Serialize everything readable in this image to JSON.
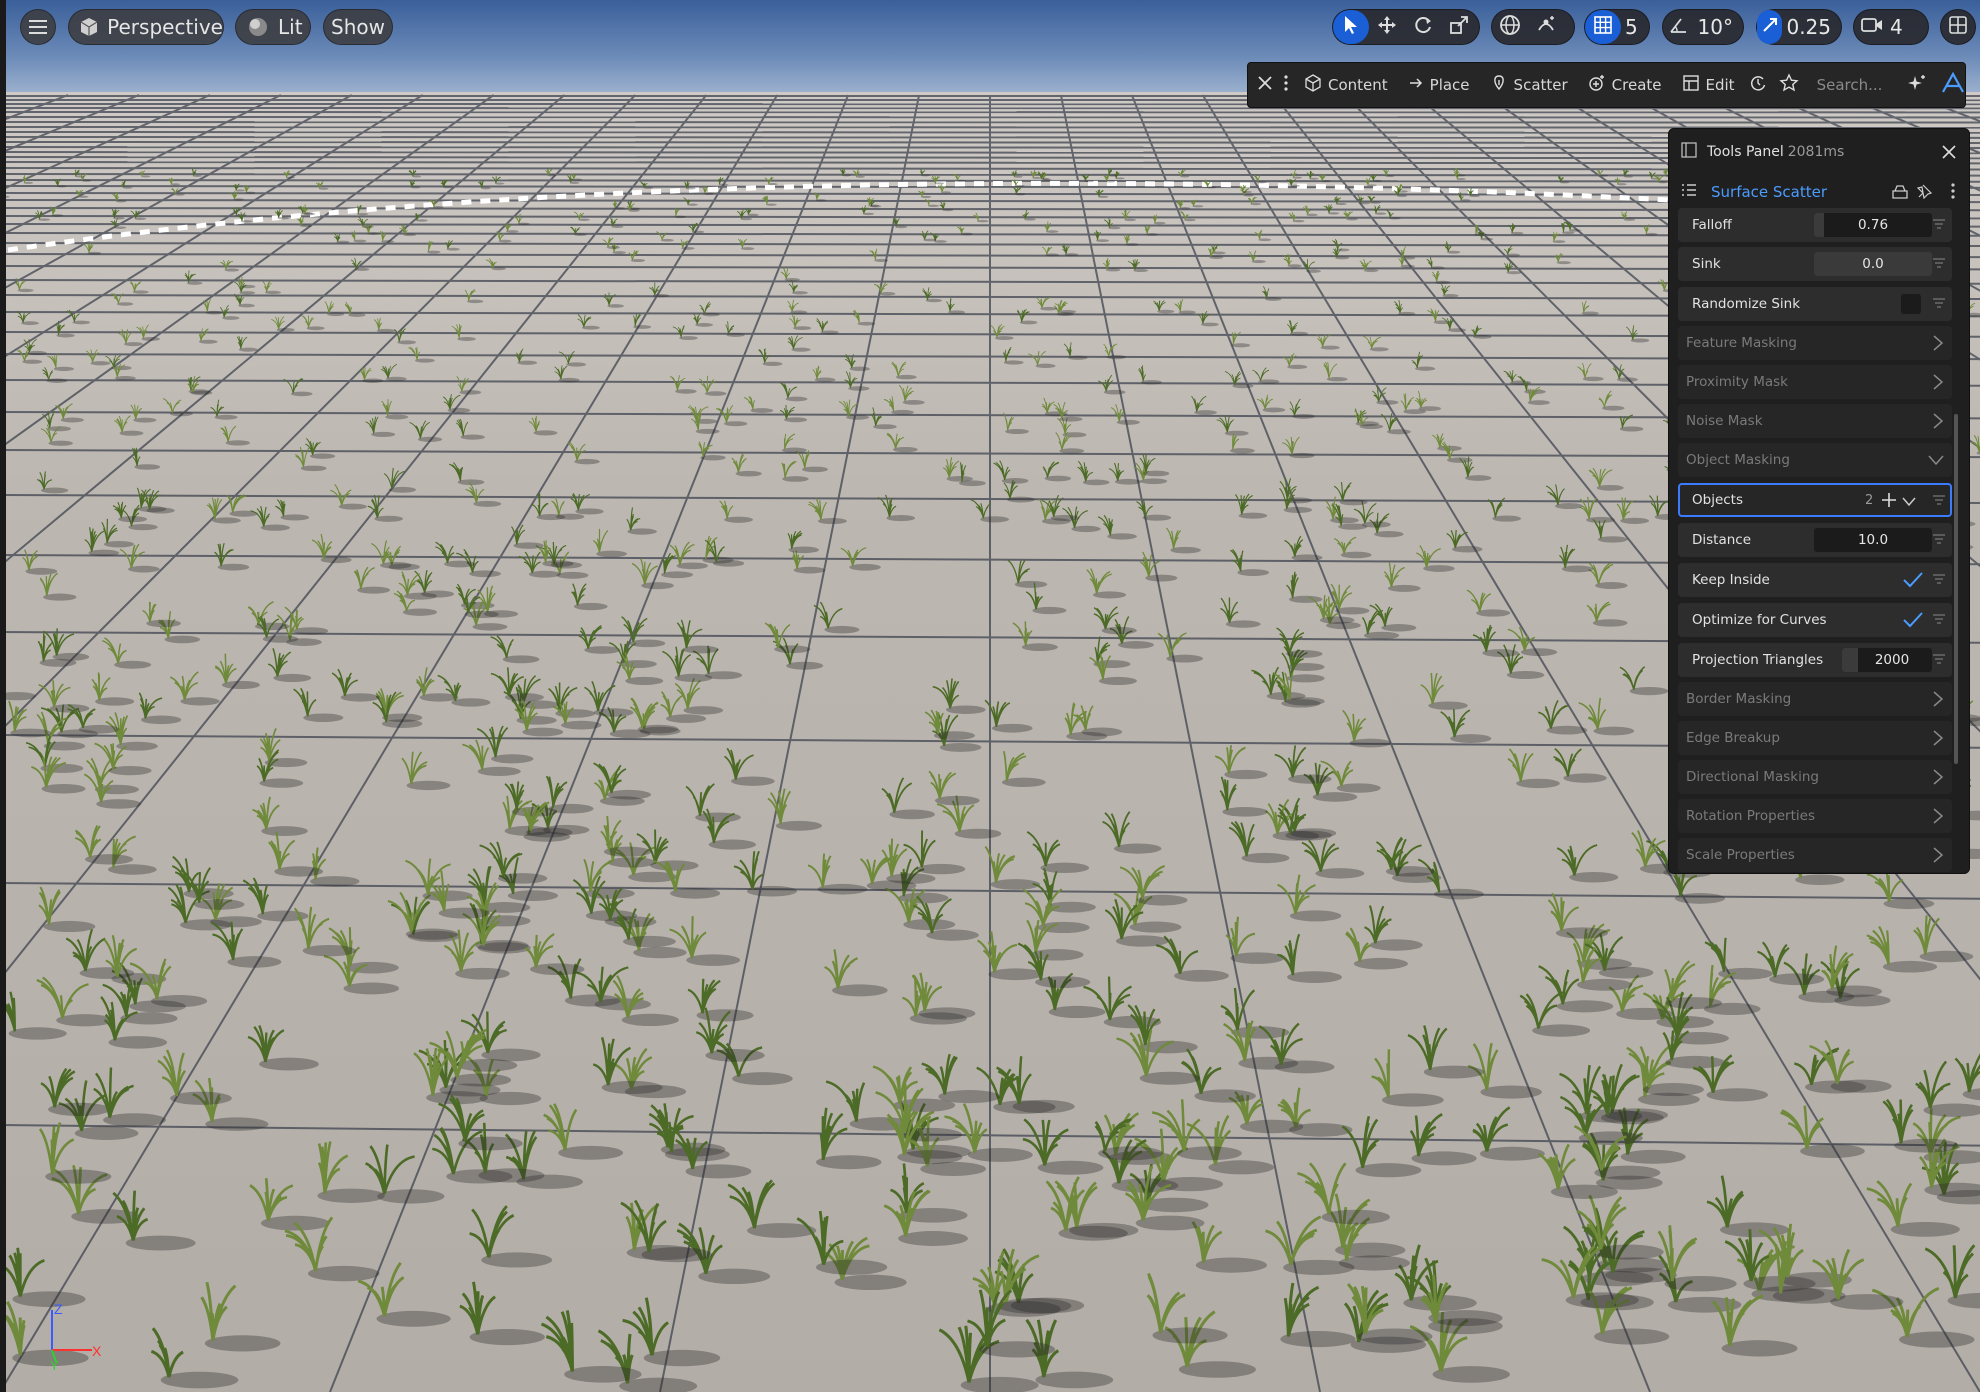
{
  "viewport": {
    "menu_icon": "hamburger-icon",
    "perspective_label": "Perspective",
    "lit_label": "Lit",
    "show_label": "Show",
    "grid_snap_value": "5",
    "rotation_snap_value": "10°",
    "scale_snap_value": "0.25",
    "camera_speed_value": "4",
    "axis_labels": {
      "z": "Z",
      "x": "X",
      "y": "Y"
    }
  },
  "modebar": {
    "content_label": "Content",
    "place_label": "Place",
    "scatter_label": "Scatter",
    "create_label": "Create",
    "edit_label": "Edit",
    "search_placeholder": "Search..."
  },
  "tools_panel": {
    "title": "Tools Panel",
    "timing": "2081ms",
    "tool_name": "Surface Scatter",
    "properties": [
      {
        "label": "Falloff",
        "value": "0.76",
        "type": "number"
      },
      {
        "label": "Sink",
        "value": "0.0",
        "type": "number"
      },
      {
        "label": "Randomize Sink",
        "value": "",
        "type": "checkbox",
        "checked": false
      }
    ],
    "sections_top": [
      "Feature Masking",
      "Proximity Mask",
      "Noise Mask",
      "Object Masking"
    ],
    "object_masking": [
      {
        "label": "Objects",
        "value": "2",
        "type": "array"
      },
      {
        "label": "Distance",
        "value": "10.0",
        "type": "number"
      },
      {
        "label": "Keep Inside",
        "value": "",
        "type": "checkbox",
        "checked": true
      },
      {
        "label": "Optimize for Curves",
        "value": "",
        "type": "checkbox",
        "checked": true
      },
      {
        "label": "Projection Triangles",
        "value": "2000",
        "type": "number"
      }
    ],
    "sections_bottom": [
      "Border Masking",
      "Edge Breakup",
      "Directional Masking",
      "Rotation Properties",
      "Scale Properties"
    ]
  },
  "colors": {
    "accent": "#1a5fd6",
    "link": "#4b9cff",
    "sky_top": "#3f6aa8",
    "floor": "#b9b4ae",
    "grass": "#4c6b26"
  }
}
